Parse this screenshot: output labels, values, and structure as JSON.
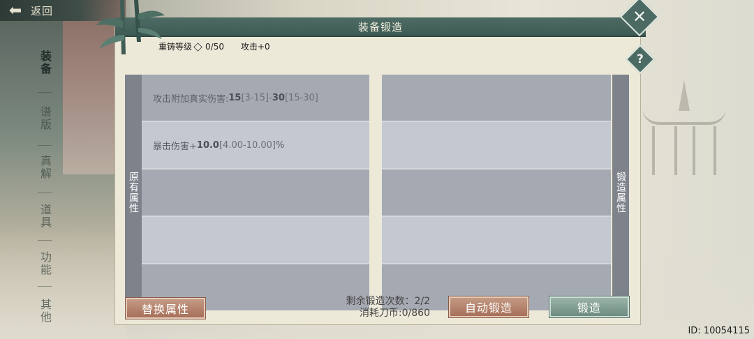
{
  "nav": {
    "back_label": "返回"
  },
  "side_tabs": [
    {
      "label": "装备",
      "active": true
    },
    {
      "label": "谱版",
      "active": false
    },
    {
      "label": "真解",
      "active": false
    },
    {
      "label": "道具",
      "active": false
    },
    {
      "label": "功能",
      "active": false
    },
    {
      "label": "其他",
      "active": false
    }
  ],
  "panel": {
    "title": "装备锻造",
    "reforge_level_label": "重铸等级",
    "reforge_level_value": "0/50",
    "attack_bonus": "攻击+0",
    "original_attr_label": "原有属性",
    "forged_attr_label": "锻造属性"
  },
  "original_rows": [
    {
      "label": "攻击附加真实伤害:",
      "v1": "15",
      "r1": "[3-15]",
      "sep": "-",
      "v2": "30",
      "r2": "[15-30]",
      "suffix": ""
    },
    {
      "label": "暴击伤害+",
      "v1": "10.0",
      "r1": "[4.00-10.00]",
      "sep": "",
      "v2": "",
      "r2": "",
      "suffix": "%"
    },
    {
      "label": "",
      "v1": "",
      "r1": "",
      "sep": "",
      "v2": "",
      "r2": "",
      "suffix": ""
    },
    {
      "label": "",
      "v1": "",
      "r1": "",
      "sep": "",
      "v2": "",
      "r2": "",
      "suffix": ""
    },
    {
      "label": "",
      "v1": "",
      "r1": "",
      "sep": "",
      "v2": "",
      "r2": "",
      "suffix": ""
    }
  ],
  "forged_rows": [
    "",
    "",
    "",
    "",
    ""
  ],
  "controls": {
    "replace_button": "替换属性",
    "remaining_forge": "剩余锻造次数：2/2",
    "cost": "消耗刀币:0/860",
    "auto_forge_button": "自动锻造",
    "forge_button": "锻造"
  },
  "footer": {
    "id_text": "ID: 10054115"
  },
  "colors": {
    "header": "#3e5a54",
    "orange_button": "#a7705a",
    "green_button": "#6d8c80"
  }
}
